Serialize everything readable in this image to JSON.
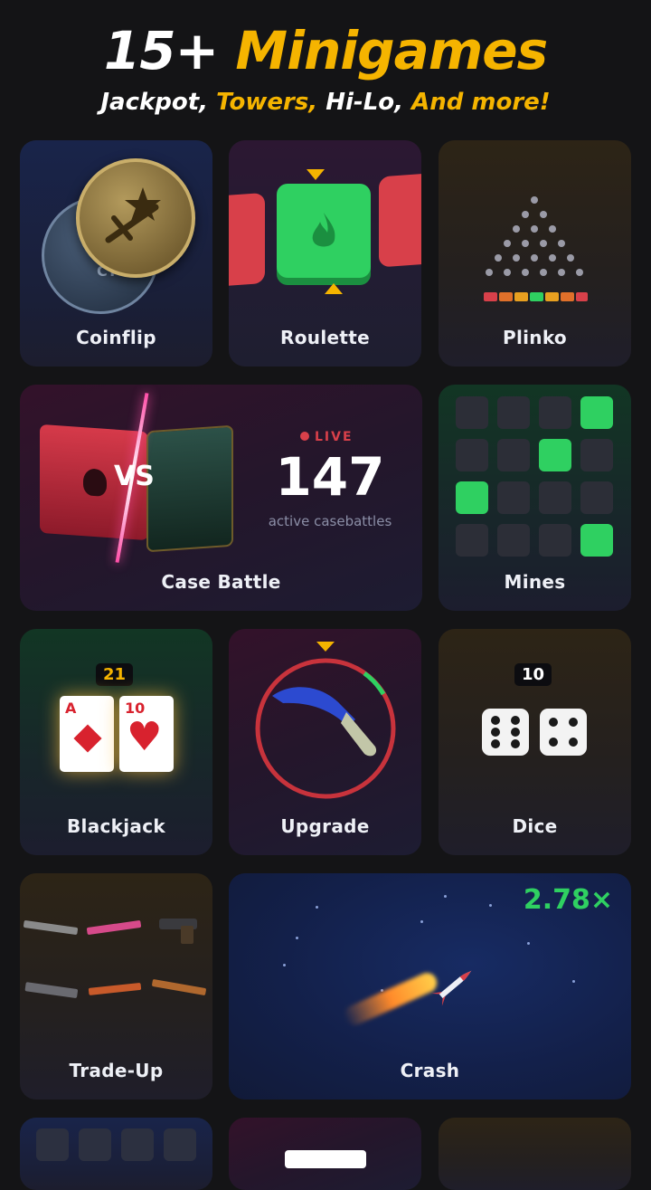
{
  "header": {
    "title_prefix": "15+",
    "title_highlight": "Minigames",
    "sub_parts": [
      "Jackpot,",
      "Towers,",
      "Hi-Lo,",
      "And more!"
    ]
  },
  "games": {
    "coinflip": "Coinflip",
    "roulette": "Roulette",
    "plinko": "Plinko",
    "case_battle": "Case Battle",
    "mines": "Mines",
    "blackjack": "Blackjack",
    "upgrade": "Upgrade",
    "dice": "Dice",
    "trade_up": "Trade-Up",
    "crash": "Crash"
  },
  "case_battle": {
    "live_label": "LIVE",
    "count": "147",
    "count_caption": "active casebattles",
    "vs_label": "VS",
    "coin_ct_label": "CT"
  },
  "blackjack": {
    "total": "21",
    "card1_rank": "A",
    "card2_rank": "10"
  },
  "dice": {
    "total": "10"
  },
  "crash": {
    "multiplier": "2.78×"
  },
  "colors": {
    "accent_yellow": "#f5b400",
    "green": "#2fd061",
    "red": "#d8404a"
  }
}
